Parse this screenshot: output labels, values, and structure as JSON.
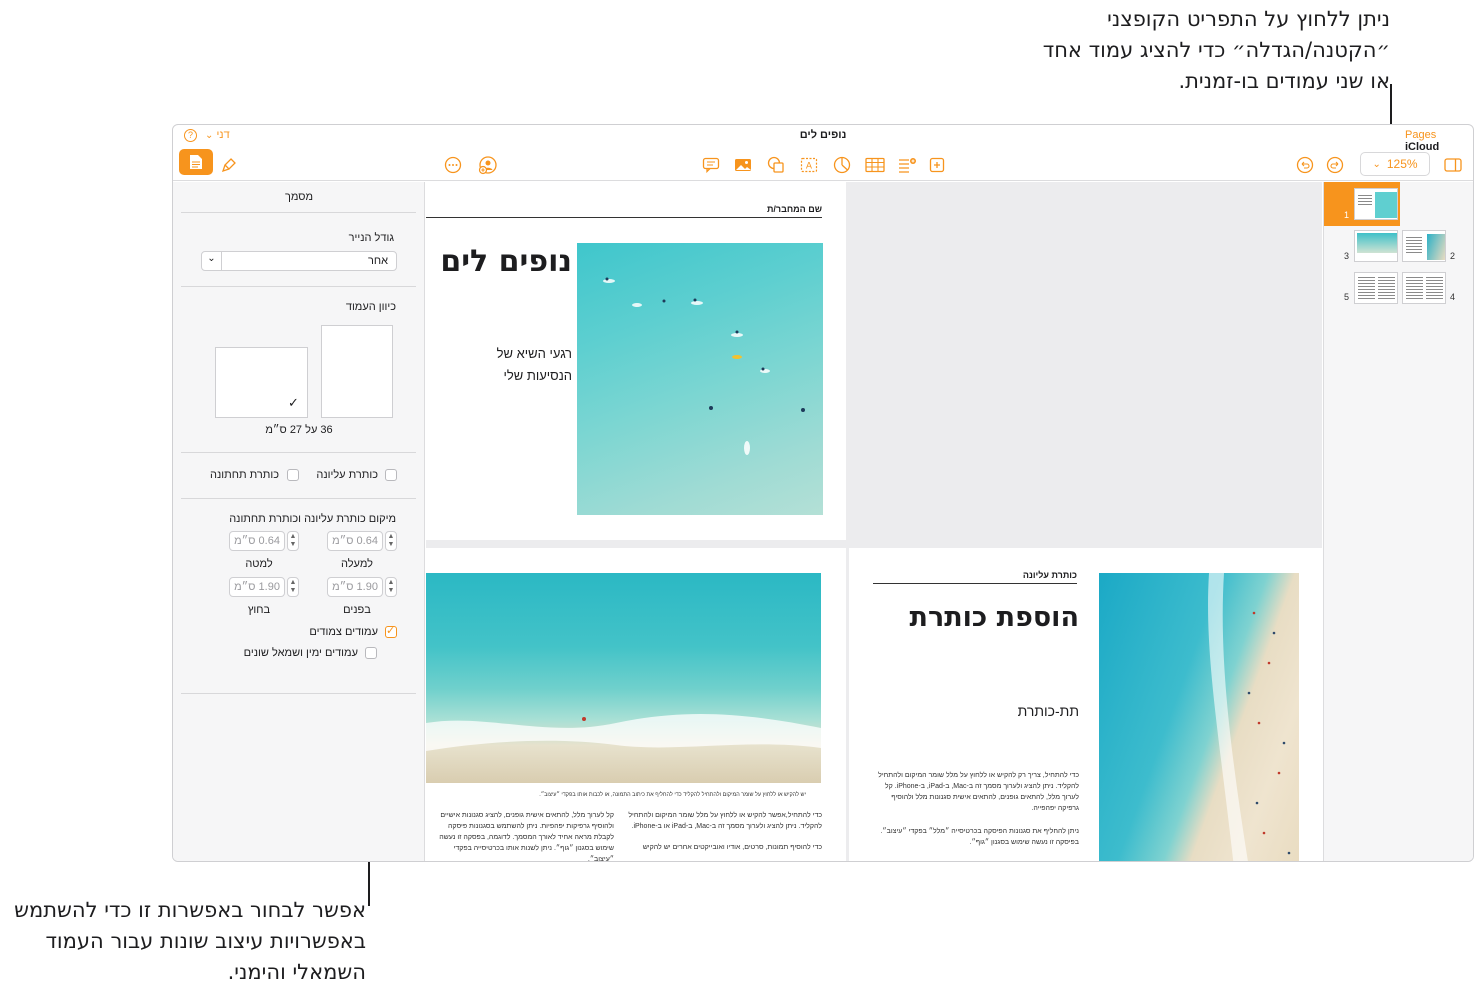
{
  "callouts": {
    "top_right": "ניתן ללחוץ על התפריט הקופצני ״הקטנה/הגדלה״ כדי להציג עמוד אחד או שני עמודים בו-זמנית.",
    "bottom_left": "אפשר לבחור באפשרות זו כדי להשתמש באפשרויות עיצוב שונות עבור העמוד השמאלי והימני."
  },
  "titlebar": {
    "icloud": "iCloud",
    "app": "Pages",
    "doc_title": "נופים לים",
    "user": "דני"
  },
  "toolbar": {
    "zoom": "125%"
  },
  "format_pane": {
    "header": "מסמך",
    "paper_size_label": "גודל הנייר",
    "paper_size_value": "אחר",
    "orientation_label": "כיוון העמוד",
    "dimensions": "36 על 27 ס״מ",
    "header_checkbox": "כותרת עליונה",
    "footer_checkbox": "כותרת תחתונה",
    "hf_position_label": "מיקום כותרת עליונה וכותרת תחתונה",
    "top_value": "0.64 ס״מ",
    "top_label": "למעלה",
    "bottom_value": "0.64 ס״מ",
    "bottom_label": "למטה",
    "inside_value": "1.90 ס״מ",
    "inside_label": "בפנים",
    "outside_value": "1.90 ס״מ",
    "outside_label": "בחוץ",
    "facing_pages": "עמודים צמודים",
    "different_lr": "עמודים ימין ושמאל שונים"
  },
  "page1": {
    "author": "שם המחבר/ת",
    "title": "נופים לים",
    "subtitle_line1": "רגעי השיא של",
    "subtitle_line2": "הנסיעות שלי"
  },
  "page2": {
    "caption": "יש להקיש או ללחוץ על שומר המיקום ולהתחיל להקליד כדי להחליף את כיתוב התמונה, או לכבות אותו בפקדי ״עיצוב״.",
    "col1_p1": "כדי להתחיל,אפשר להקיש או ללחוץ על מלל שומר המיקום ולהתחיל להקליד. ניתן להציג ולערוך מסמך זה ב-Mac, ב-iPad או ב-iPhone.",
    "col1_p2": "כדי להוסיף תמונות, סרטים, אודיו ואובייקטים אחרים יש להקיש",
    "col2_p1": "קל לערוך מלל, להתאים אישית גופנים, להציג סגנונות אישיים ולהוסיף גרפיקות יפהפיות. ניתן להשתמש בסגנונות פיסקה לקבלת מראה אחיד לאורך המסמך. לדוגמה, בפסקה זו נעשה שימוש בסגנון ״גוף״. ניתן לשנות אותו בכרטיסייה בפקדי ״עיצוב״."
  },
  "page3": {
    "header": "כותרת עליונה",
    "title": "הוספת כותרת",
    "subtitle": "תת-כותרת",
    "body_p1": "כדי להתחיל, צריך רק להקיש או ללחוץ על מלל שומר המיקום ולהתחיל להקליד. ניתן להציג ולערוך מסמך זה ב-Mac, ב-iPad, ב-iPhone. קל לערוך מלל, להתאים גופנים, להתאים אישית סגנונות מלל ולהוסיף גרפיקה יפהפייה.",
    "body_p2": "ניתן להחליף את סגנונות הפיסקה בכרטיסייה ״מלל״ בפקדי ״עיצוב״. בפיסקה זו נעשה שימוש בסגנון ״גוף״."
  },
  "thumbnails": {
    "n1": "1",
    "n2": "2",
    "n3": "3",
    "n4": "4",
    "n5": "5"
  },
  "colors": {
    "accent": "#f7941d"
  }
}
